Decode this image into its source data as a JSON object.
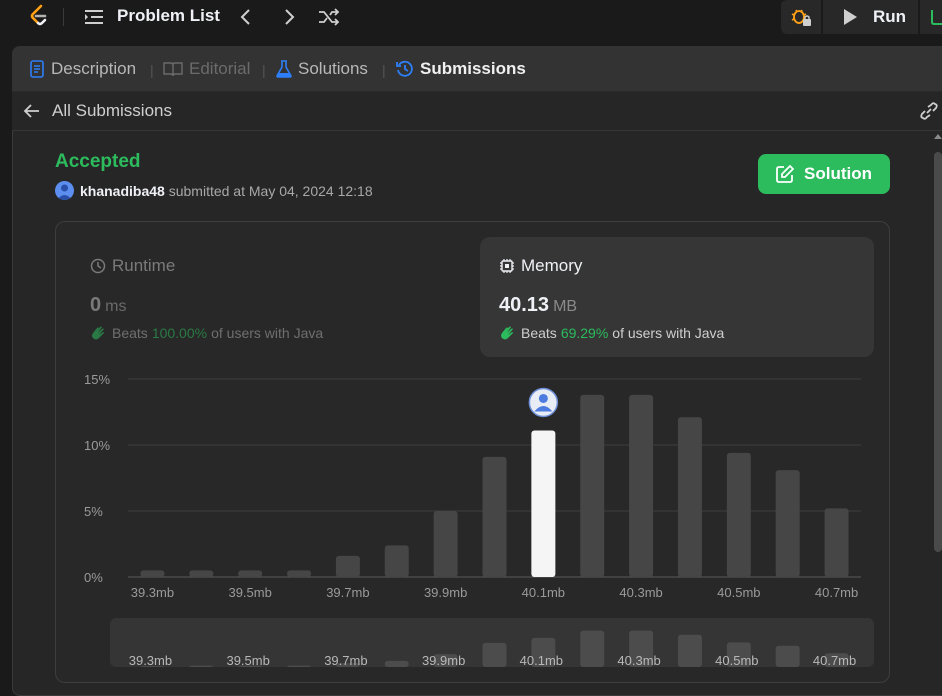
{
  "topbar": {
    "problem_list": "Problem List",
    "run": "Run"
  },
  "tabs": [
    {
      "label": "Description",
      "state": "normal"
    },
    {
      "label": "Editorial",
      "state": "disabled"
    },
    {
      "label": "Solutions",
      "state": "normal"
    },
    {
      "label": "Submissions",
      "state": "active"
    }
  ],
  "subbar": {
    "back_label": "All Submissions"
  },
  "submission": {
    "status": "Accepted",
    "username": "khanadiba48",
    "submitted_text": " submitted at May 04, 2024 12:18",
    "solution_button": "Solution"
  },
  "runtime": {
    "title": "Runtime",
    "value": "0",
    "unit": "ms",
    "beats_label": "Beats",
    "beats_pct": "100.00%",
    "beats_suffix": "of users with Java"
  },
  "memory": {
    "title": "Memory",
    "value": "40.13",
    "unit": "MB",
    "beats_label": "Beats",
    "beats_pct": "69.29%",
    "beats_suffix": "of users with Java"
  },
  "colors": {
    "accent_green": "#2cbb5d",
    "blue": "#2d7ff9",
    "bar": "#464646",
    "bar_highlight": "#f5f5f5"
  },
  "chart_data": {
    "type": "bar",
    "yticks": [
      "15%",
      "10%",
      "5%",
      "0%"
    ],
    "ylim": [
      0,
      15
    ],
    "xticks": [
      "39.3mb",
      "39.5mb",
      "39.7mb",
      "39.9mb",
      "40.1mb",
      "40.3mb",
      "40.5mb",
      "40.7mb"
    ],
    "values": [
      0.5,
      0.5,
      0.5,
      0.5,
      1.6,
      2.4,
      5.0,
      9.1,
      11.1,
      13.8,
      13.8,
      12.1,
      9.4,
      8.1,
      5.2
    ],
    "highlight_index": 8,
    "mini_values": [
      0.3,
      0.5,
      0.5,
      0.5,
      1.4,
      2.2,
      4.6,
      8.6,
      10.4,
      13.0,
      13.0,
      11.5,
      8.8,
      7.6,
      4.9
    ]
  }
}
